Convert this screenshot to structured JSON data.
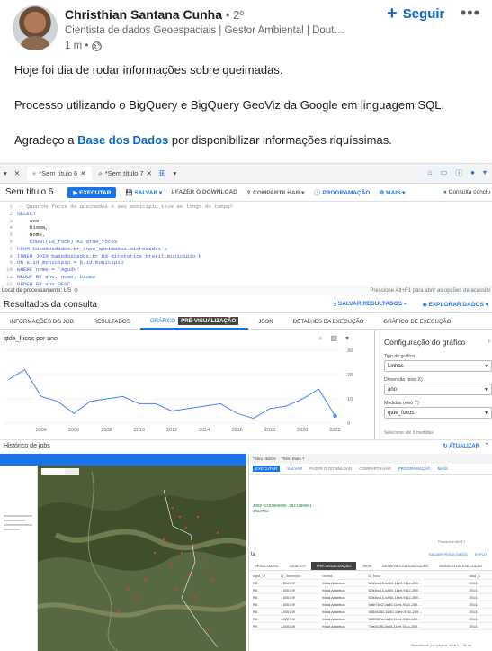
{
  "post": {
    "author": "Christhian Santana Cunha",
    "degree": "• 2º",
    "headline": "Cientista de dados Geoespaciais | Gestor Ambiental | Dout…",
    "time": "1 m •",
    "follow_label": "Seguir",
    "more_label": "•••",
    "text_line1": "Hoje foi dia de rodar informações sobre queimadas.",
    "text_line2": "Processo utilizando o BigQuery e BigQuery GeoViz da Google em linguagem SQL.",
    "text_line3_prefix": "Agradeço a ",
    "text_line3_link": "Base dos Dados",
    "text_line3_suffix": " por disponibilizar informações riquíssimas."
  },
  "bq": {
    "tab1": "*Sem título 6",
    "tab2": "*Sem título 7",
    "doc_title": "Sem título 6",
    "run": "EXECUTAR",
    "save": "SALVAR",
    "download": "FAZER O DOWNLOAD",
    "share": "COMPARTILHAR",
    "schedule": "PROGRAMAÇÃO",
    "more": "MAIS",
    "status": "Consulta conclu",
    "code": [
      "-- Quantos focos de queimadas o seu município teve ao longo do tempo?",
      "SELECT",
      "    ano,",
      "    bioma,",
      "    nome,",
      "    COUNT(id_foco) AS qtde_focos",
      "FROM basedosdados.br_inpe_queimadas.microdados a",
      "INNER JOIN basedosdados.br_bd_diretorios_brasil.municipio b",
      "ON a.id_municipio = b.id_municipio",
      "WHERE nome = 'Agudo'",
      "GROUP BY ano, nome, bioma",
      "ORDER BY ano DESC"
    ],
    "local": "Local de processamento: US",
    "hint": "Pressione Alt+F1 para abrir as opções de acessibi",
    "results_title": "Resultados da consulta",
    "save_results": "SALVAR RESULTADOS",
    "explore": "EXPLORAR DADOS",
    "tabs": [
      "INFORMAÇÕES DO JOB",
      "RESULTADOS",
      "GRÁFICO",
      "PRÉ-VISUALIZAÇÃO",
      "JSON",
      "DETALHES DA EXECUÇÃO",
      "GRÁFICO DE EXECUÇÃO"
    ],
    "chart_label": "qtde_focos por ano",
    "config_title": "Configuração do gráfico",
    "cfg_type_label": "Tipo de gráfico",
    "cfg_type": "Linhas",
    "cfg_dim_label": "Dimensão (eixo X)",
    "cfg_dim": "ano",
    "cfg_meas_label": "Medidas (eixo Y)",
    "cfg_meas": "qtde_focos",
    "cfg_note": "Selecione até 5 medidas",
    "jobs": "Histórico de jobs",
    "update": "ATUALIZAR"
  },
  "chart_data": {
    "type": "line",
    "title": "qtde_focos por ano",
    "x": [
      2002,
      2003,
      2004,
      2005,
      2006,
      2007,
      2008,
      2009,
      2010,
      2011,
      2012,
      2013,
      2014,
      2015,
      2016,
      2017,
      2018,
      2019,
      2020,
      2021,
      2022
    ],
    "series": [
      {
        "values": [
          18,
          22,
          11,
          9,
          4,
          9,
          10,
          11,
          8,
          8,
          5,
          6,
          7,
          8,
          4,
          2,
          6,
          7,
          10,
          14,
          3
        ]
      }
    ],
    "xticks": [
      2004,
      2006,
      2008,
      2010,
      2012,
      2014,
      2016,
      2018,
      2020,
      2022
    ],
    "yticks": [
      0,
      10,
      20,
      30
    ],
    "ylim": [
      0,
      30
    ],
    "color": "#4285f4"
  },
  "bq2": {
    "tab1": "*Sem título 6",
    "tab2": "*Sem título 7",
    "run": "EXECUTAR",
    "save": "SALVAR",
    "download": "FAZER O DOWNLOAD",
    "share": "COMPARTILHAR",
    "schedule": "PROGRAMAÇÃO",
    "more": "MAIS",
    "code_a": "4309-1382909008-2021100801",
    "code_b": "2022TO2",
    "hint": "Pressione Alt+F1",
    "res_label": "ta",
    "save_res": "SALVAR RESULTADOS",
    "explore": "EXPLO",
    "tabs": [
      "RESULTADOS",
      "GRÁFICO",
      "PRÉ-VISUALIZAÇÃO",
      "JSON",
      "DETALHES DA EXECUÇÃO",
      "GRÁFICO DE EXECUÇÃO"
    ],
    "headers": [
      "sigla_uf",
      "id_municipio",
      "bioma",
      "id_foco",
      "data_h"
    ],
    "rows": [
      [
        "RS",
        "4300109",
        "Mata Atlântica",
        "62d5cc15-0a50-11e9-911c-289…",
        "2014-"
      ],
      [
        "RS",
        "4300109",
        "Mata Atlântica",
        "62d5cc15-0a50-11e9-911c-289…",
        "2014-"
      ],
      [
        "RS",
        "4300109",
        "Mata Atlântica",
        "62d5cc15-0a50-11e9-911c-289…",
        "2014-"
      ],
      [
        "RS",
        "4300109",
        "Mata Atlântica",
        "6d6f78e2-0a50-11e9-911c-289…",
        "2014-"
      ],
      [
        "RS",
        "4300109",
        "Mata Atlântica",
        "565d3282-0a50-11e9-911c-289…",
        "2013-"
      ],
      [
        "RS",
        "4322709",
        "Mata Atlântica",
        "589f567a-0a50-11e9-911c-289…",
        "2014-"
      ],
      [
        "RS",
        "4300109",
        "Mata Atlântica",
        "7de0c2f5-0a50-11e9-911c-289…",
        "2014-"
      ]
    ],
    "footer": "Resultados por página: 50 ▾  1 – 50 de"
  },
  "colors": {
    "linkedin_blue": "#0a66c2",
    "google_blue": "#1a73e8"
  }
}
